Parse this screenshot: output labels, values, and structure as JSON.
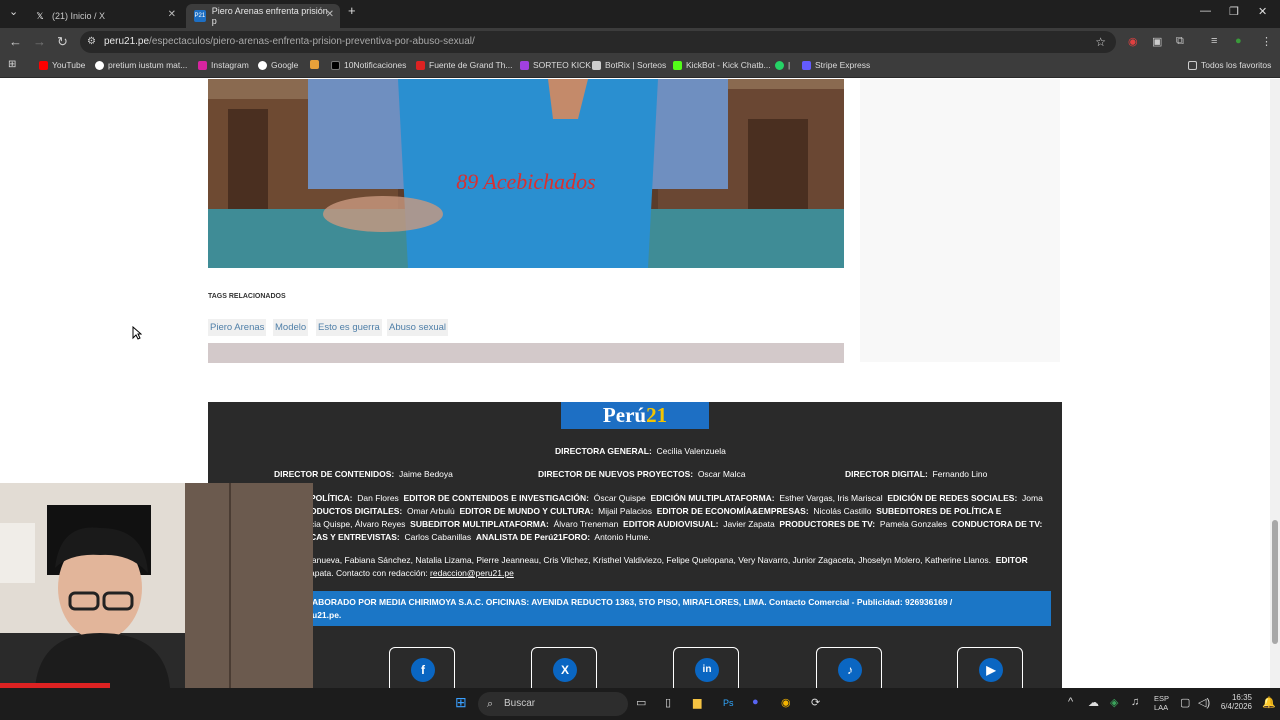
{
  "browser": {
    "tabs": [
      {
        "title": "(21) Inicio / X",
        "icon": "x-icon"
      },
      {
        "title": "Piero Arenas enfrenta prisión p",
        "icon": "peru21-icon"
      }
    ],
    "new_tab": "+",
    "url_domain": "peru21.pe",
    "url_path": "/espectaculos/piero-arenas-enfrenta-prision-preventiva-por-abuso-sexual/",
    "bookmarks": [
      "YouTube",
      "pretium iustum mat...",
      "Instagram",
      "Google",
      "10Notificaciones",
      "Fuente de Grand Th...",
      "SORTEO KICK",
      "BotRix | Sorteos",
      "KickBot - Kick Chatb...",
      "|",
      "Stripe Express"
    ],
    "all_bookmarks": "Todos los favoritos"
  },
  "article": {
    "image_text": "89 Acebichados",
    "tags_heading": "TAGS RELACIONADOS",
    "tags": [
      "Piero Arenas",
      "Modelo",
      "Esto es guerra",
      "Abuso sexual"
    ]
  },
  "footer": {
    "logo_main": "Perú",
    "logo_num": "21",
    "directora_label": "DIRECTORA GENERAL:",
    "directora": "Cecilia Valenzuela",
    "row2": [
      {
        "label": "DIRECTOR DE CONTENIDOS:",
        "name": "Jaime Bedoya"
      },
      {
        "label": "DIRECTOR DE NUEVOS PROYECTOS:",
        "name": "Oscar Malca"
      },
      {
        "label": "DIRECTOR DIGITAL:",
        "name": "Fernando Lino"
      }
    ],
    "l1": [
      {
        "label": "POLÍTICA:",
        "name": "Dan Flores"
      },
      {
        "label": "EDITOR DE CONTENIDOS E INVESTIGACIÓN:",
        "name": "Óscar Quispe"
      },
      {
        "label": "EDICIÓN MULTIPLATAFORMA:",
        "name": "Esther Vargas, Iris Mariscal"
      },
      {
        "label": "EDICIÓN DE REDES SOCIALES:",
        "name": "Joma"
      }
    ],
    "l2": [
      {
        "label": "ODUCTOS DIGITALES:",
        "name": "Omar Arbulú"
      },
      {
        "label": "EDITOR DE MUNDO Y CULTURA:",
        "name": "Mijail Palacios"
      },
      {
        "label": "EDITOR DE ECONOMÍA&EMPRESAS:",
        "name": "Nicolás Castillo"
      },
      {
        "label": "SUBEDITORES DE POLÍTICA E",
        "name": ""
      }
    ],
    "l3_lead": "cia Quispe, Álvaro Reyes",
    "l3": [
      {
        "label": "SUBEDITOR MULTIPLATAFORMA:",
        "name": "Álvaro Treneman"
      },
      {
        "label": "EDITOR AUDIOVISUAL:",
        "name": "Javier Zapata"
      },
      {
        "label": "PRODUCTORES DE TV:",
        "name": "Pamela Gonzales"
      },
      {
        "label": "CONDUCTORA DE TV:",
        "name": ""
      }
    ],
    "l4": [
      {
        "label": "CAS Y ENTREVISTAS:",
        "name": "Carlos Cabanillas"
      },
      {
        "label": "ANALISTA DE Perú21FORO:",
        "name": "Antonio Hume."
      }
    ],
    "staff": "lanueva, Fabiana Sánchez, Natalia Lizama, Pierre Jeanneau, Cris Vilchez, Kristhel Valdiviezo, Felipe Quelopana, Very Navarro, Junior Zagaceta, Jhoselyn Molero, Katherine Llanos.",
    "staff_editor": "EDITOR",
    "contact_lead": "apata. Contacto con redacción:",
    "contact_email": "redaccion@peru21.pe",
    "blue1": "ABORADO POR MEDIA CHIRIMOYA S.A.C. OFICINAS: AVENIDA REDUCTO 1363, 5TO PISO, MIRAFLORES, LIMA. Contacto Comercial - Publicidad: 926936169 /",
    "blue2": "u21.pe.",
    "socials": [
      "facebook-icon",
      "x-icon",
      "linkedin-icon",
      "tiktok-icon",
      "youtube-icon"
    ]
  },
  "taskbar": {
    "search": "Buscar",
    "lang1": "ESP",
    "lang2": "LAA",
    "time": "16:35",
    "date": "6/4/2026"
  },
  "colors": {
    "brand_blue": "#1d6fc4",
    "logo_yellow": "#f4c400",
    "footer_bg": "#2a2a2a",
    "tag_text": "#4f7fa8"
  }
}
